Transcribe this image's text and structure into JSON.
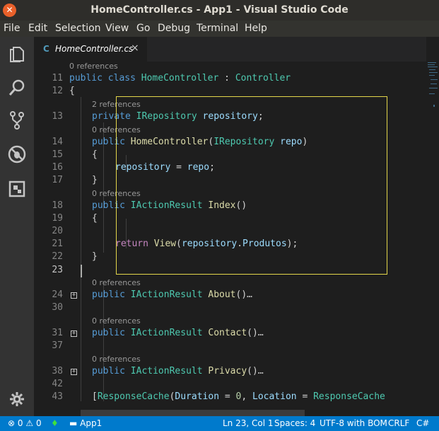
{
  "window": {
    "title": "HomeController.cs - App1 - Visual Studio Code"
  },
  "menu": {
    "items": [
      "File",
      "Edit",
      "Selection",
      "View",
      "Go",
      "Debug",
      "Terminal",
      "Help"
    ]
  },
  "activity_bar": {
    "icons": [
      "explorer-icon",
      "search-icon",
      "source-control-icon",
      "debug-icon",
      "extensions-icon",
      "settings-gear-icon"
    ]
  },
  "tab": {
    "icon": "C",
    "label": "HomeController.cs",
    "close": "×"
  },
  "editor": {
    "lines": [
      {
        "n": "11",
        "tokens": [
          [
            "kw",
            "public"
          ],
          [
            "pl",
            " "
          ],
          [
            "kw",
            "class"
          ],
          [
            "pl",
            " "
          ],
          [
            "ty",
            "HomeController"
          ],
          [
            "pl",
            " : "
          ],
          [
            "ty",
            "Controller"
          ]
        ]
      },
      {
        "n": "12",
        "tokens": [
          [
            "pl",
            "{"
          ]
        ]
      },
      {
        "n": "13",
        "tokens": [
          [
            "kw",
            "private"
          ],
          [
            "pl",
            " "
          ],
          [
            "ty",
            "IRepository"
          ],
          [
            "pl",
            " "
          ],
          [
            "id",
            "repository"
          ],
          [
            "pl",
            ";"
          ]
        ]
      },
      {
        "n": "14",
        "tokens": [
          [
            "kw",
            "public"
          ],
          [
            "pl",
            " "
          ],
          [
            "fn",
            "HomeController"
          ],
          [
            "pl",
            "("
          ],
          [
            "ty",
            "IRepository"
          ],
          [
            "pl",
            " "
          ],
          [
            "id",
            "repo"
          ],
          [
            "pl",
            ")"
          ]
        ]
      },
      {
        "n": "15",
        "tokens": [
          [
            "pl",
            "{"
          ]
        ]
      },
      {
        "n": "16",
        "tokens": [
          [
            "id",
            "repository"
          ],
          [
            "pl",
            " = "
          ],
          [
            "id",
            "repo"
          ],
          [
            "pl",
            ";"
          ]
        ]
      },
      {
        "n": "17",
        "tokens": [
          [
            "pl",
            "}"
          ]
        ]
      },
      {
        "n": "18",
        "tokens": [
          [
            "kw",
            "public"
          ],
          [
            "pl",
            " "
          ],
          [
            "ty",
            "IActionResult"
          ],
          [
            "pl",
            " "
          ],
          [
            "fn",
            "Index"
          ],
          [
            "pl",
            "()"
          ]
        ]
      },
      {
        "n": "19",
        "tokens": [
          [
            "pl",
            "{"
          ]
        ]
      },
      {
        "n": "20",
        "tokens": []
      },
      {
        "n": "21",
        "tokens": [
          [
            "ctl",
            "return"
          ],
          [
            "pl",
            " "
          ],
          [
            "fn",
            "View"
          ],
          [
            "pl",
            "("
          ],
          [
            "id",
            "repository"
          ],
          [
            "pl",
            "."
          ],
          [
            "id",
            "Produtos"
          ],
          [
            "pl",
            ");"
          ]
        ]
      },
      {
        "n": "22",
        "tokens": [
          [
            "pl",
            "}"
          ]
        ]
      },
      {
        "n": "23",
        "tokens": []
      },
      {
        "n": "24",
        "tokens": [
          [
            "kw",
            "public"
          ],
          [
            "pl",
            " "
          ],
          [
            "ty",
            "IActionResult"
          ],
          [
            "pl",
            " "
          ],
          [
            "fn",
            "About"
          ],
          [
            "pl",
            "()"
          ],
          [
            "ell",
            "…"
          ]
        ]
      },
      {
        "n": "30",
        "tokens": []
      },
      {
        "n": "31",
        "tokens": [
          [
            "kw",
            "public"
          ],
          [
            "pl",
            " "
          ],
          [
            "ty",
            "IActionResult"
          ],
          [
            "pl",
            " "
          ],
          [
            "fn",
            "Contact"
          ],
          [
            "pl",
            "()"
          ],
          [
            "ell",
            "…"
          ]
        ]
      },
      {
        "n": "37",
        "tokens": []
      },
      {
        "n": "38",
        "tokens": [
          [
            "kw",
            "public"
          ],
          [
            "pl",
            " "
          ],
          [
            "ty",
            "IActionResult"
          ],
          [
            "pl",
            " "
          ],
          [
            "fn",
            "Privacy"
          ],
          [
            "pl",
            "()"
          ],
          [
            "ell",
            "…"
          ]
        ]
      },
      {
        "n": "42",
        "tokens": []
      },
      {
        "n": "43",
        "tokens": [
          [
            "pl",
            "["
          ],
          [
            "ty",
            "ResponseCache"
          ],
          [
            "pl",
            "("
          ],
          [
            "id",
            "Duration"
          ],
          [
            "pl",
            " = "
          ],
          [
            "num",
            "0"
          ],
          [
            "pl",
            ", "
          ],
          [
            "id",
            "Location"
          ],
          [
            "pl",
            " = "
          ],
          [
            "ty",
            "ResponseCache"
          ]
        ]
      }
    ],
    "codelens": [
      {
        "text": "0 references",
        "before": "11"
      },
      {
        "text": "2 references",
        "before": "13"
      },
      {
        "text": "0 references",
        "before": "14"
      },
      {
        "text": "0 references",
        "before": "18"
      },
      {
        "text": "0 references",
        "before": "24"
      },
      {
        "text": "0 references",
        "before": "31"
      },
      {
        "text": "0 references",
        "before": "38"
      }
    ],
    "active_line": "23"
  },
  "status": {
    "errors": "0",
    "warnings": "0",
    "project": "App1",
    "position": "Ln 23, Col 1",
    "spaces": "Spaces: 4",
    "encoding": "UTF-8 with BOM",
    "eol": "CRLF",
    "language": "C#"
  },
  "colors": {
    "status_bar": "#007acc",
    "highlight_box": "#e3d64a",
    "activity_bar": "#333333"
  }
}
